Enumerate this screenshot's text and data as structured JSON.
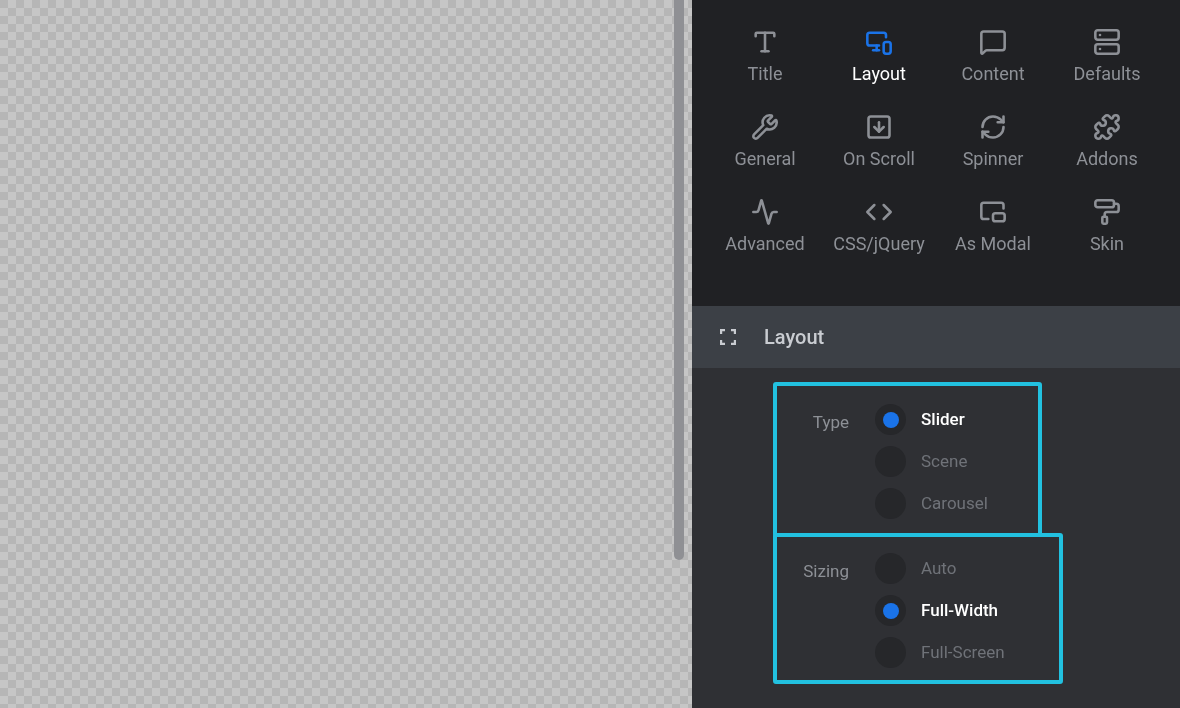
{
  "tabs": [
    {
      "label": "Title",
      "selected": false
    },
    {
      "label": "Layout",
      "selected": true
    },
    {
      "label": "Content",
      "selected": false
    },
    {
      "label": "Defaults",
      "selected": false
    },
    {
      "label": "General",
      "selected": false
    },
    {
      "label": "On Scroll",
      "selected": false
    },
    {
      "label": "Spinner",
      "selected": false
    },
    {
      "label": "Addons",
      "selected": false
    },
    {
      "label": "Advanced",
      "selected": false
    },
    {
      "label": "CSS/jQuery",
      "selected": false
    },
    {
      "label": "As Modal",
      "selected": false
    },
    {
      "label": "Skin",
      "selected": false
    }
  ],
  "section": {
    "title": "Layout"
  },
  "groups": [
    {
      "label": "Type",
      "options": [
        {
          "label": "Slider",
          "selected": true
        },
        {
          "label": "Scene",
          "selected": false
        },
        {
          "label": "Carousel",
          "selected": false
        }
      ]
    },
    {
      "label": "Sizing",
      "options": [
        {
          "label": "Auto",
          "selected": false
        },
        {
          "label": "Full-Width",
          "selected": true
        },
        {
          "label": "Full-Screen",
          "selected": false
        }
      ]
    }
  ]
}
